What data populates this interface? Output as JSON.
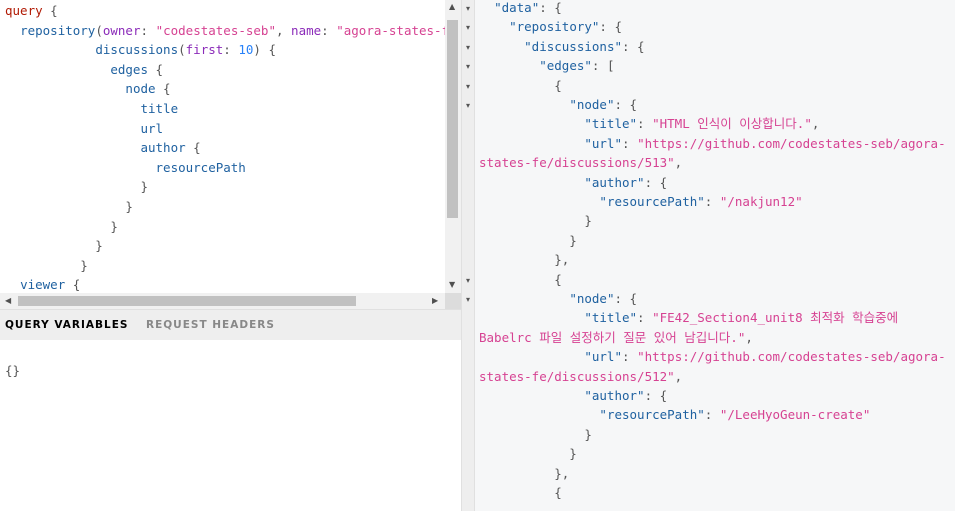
{
  "query_editor": {
    "lines": [
      [
        [
          "kw",
          "query"
        ],
        [
          "punct",
          " {"
        ]
      ],
      [
        [
          "punct",
          "  "
        ],
        [
          "field",
          "repository"
        ],
        [
          "punct",
          "("
        ],
        [
          "arg",
          "owner"
        ],
        [
          "punct",
          ": "
        ],
        [
          "str",
          "\"codestates-seb\""
        ],
        [
          "punct",
          ", "
        ],
        [
          "arg",
          "name"
        ],
        [
          "punct",
          ": "
        ],
        [
          "str",
          "\"agora-states-fe\""
        ],
        [
          "punct",
          ")"
        ]
      ],
      [
        [
          "punct",
          "            "
        ],
        [
          "field",
          "discussions"
        ],
        [
          "punct",
          "("
        ],
        [
          "arg",
          "first"
        ],
        [
          "punct",
          ": "
        ],
        [
          "num",
          "10"
        ],
        [
          "punct",
          ") {"
        ]
      ],
      [
        [
          "punct",
          "              "
        ],
        [
          "field",
          "edges"
        ],
        [
          "punct",
          " {"
        ]
      ],
      [
        [
          "punct",
          "                "
        ],
        [
          "field",
          "node"
        ],
        [
          "punct",
          " {"
        ]
      ],
      [
        [
          "punct",
          "                  "
        ],
        [
          "field",
          "title"
        ]
      ],
      [
        [
          "punct",
          "                  "
        ],
        [
          "field",
          "url"
        ]
      ],
      [
        [
          "punct",
          "                  "
        ],
        [
          "field",
          "author"
        ],
        [
          "punct",
          " {"
        ]
      ],
      [
        [
          "punct",
          "                    "
        ],
        [
          "field",
          "resourcePath"
        ]
      ],
      [
        [
          "punct",
          "                  }"
        ]
      ],
      [
        [
          "punct",
          "                }"
        ]
      ],
      [
        [
          "punct",
          "              }"
        ]
      ],
      [
        [
          "punct",
          "            }"
        ]
      ],
      [
        [
          "punct",
          "          }"
        ]
      ],
      [
        [
          "punct",
          "  "
        ],
        [
          "field",
          "viewer"
        ],
        [
          "punct",
          " {"
        ]
      ]
    ]
  },
  "tabs": {
    "variables": "QUERY VARIABLES",
    "headers": "REQUEST HEADERS"
  },
  "variables_editor": {
    "text": "{}"
  },
  "result": {
    "lines": [
      [
        [
          "punct",
          "  "
        ],
        [
          "rkey",
          "\"data\""
        ],
        [
          "punct",
          ": {"
        ]
      ],
      [
        [
          "punct",
          "    "
        ],
        [
          "rkey",
          "\"repository\""
        ],
        [
          "punct",
          ": {"
        ]
      ],
      [
        [
          "punct",
          "      "
        ],
        [
          "rkey",
          "\"discussions\""
        ],
        [
          "punct",
          ": {"
        ]
      ],
      [
        [
          "punct",
          "        "
        ],
        [
          "rkey",
          "\"edges\""
        ],
        [
          "punct",
          ": ["
        ]
      ],
      [
        [
          "punct",
          "          {"
        ]
      ],
      [
        [
          "punct",
          "            "
        ],
        [
          "rkey",
          "\"node\""
        ],
        [
          "punct",
          ": {"
        ]
      ],
      [
        [
          "punct",
          "              "
        ],
        [
          "rkey",
          "\"title\""
        ],
        [
          "punct",
          ": "
        ],
        [
          "rstr",
          "\"HTML 인식이 이상합니다.\""
        ],
        [
          "punct",
          ","
        ]
      ],
      [
        [
          "punct",
          "              "
        ],
        [
          "rkey",
          "\"url\""
        ],
        [
          "punct",
          ": "
        ],
        [
          "rstr",
          "\"https://github.com/codestates-seb/agora-"
        ]
      ],
      [
        [
          "rstr",
          "states-fe/discussions/513\""
        ],
        [
          "punct",
          ","
        ]
      ],
      [
        [
          "punct",
          "              "
        ],
        [
          "rkey",
          "\"author\""
        ],
        [
          "punct",
          ": {"
        ]
      ],
      [
        [
          "punct",
          "                "
        ],
        [
          "rkey",
          "\"resourcePath\""
        ],
        [
          "punct",
          ": "
        ],
        [
          "rstr",
          "\"/nakjun12\""
        ]
      ],
      [
        [
          "punct",
          "              }"
        ]
      ],
      [
        [
          "punct",
          "            }"
        ]
      ],
      [
        [
          "punct",
          "          },"
        ]
      ],
      [
        [
          "punct",
          "          {"
        ]
      ],
      [
        [
          "punct",
          "            "
        ],
        [
          "rkey",
          "\"node\""
        ],
        [
          "punct",
          ": {"
        ]
      ],
      [
        [
          "punct",
          "              "
        ],
        [
          "rkey",
          "\"title\""
        ],
        [
          "punct",
          ": "
        ],
        [
          "rstr",
          "\"FE42_Section4_unit8 최적화 학습중에"
        ]
      ],
      [
        [
          "rstr",
          "Babelrc 파일 설정하기 질문 있어 남깁니다.\""
        ],
        [
          "punct",
          ","
        ]
      ],
      [
        [
          "punct",
          "              "
        ],
        [
          "rkey",
          "\"url\""
        ],
        [
          "punct",
          ": "
        ],
        [
          "rstr",
          "\"https://github.com/codestates-seb/agora-"
        ]
      ],
      [
        [
          "rstr",
          "states-fe/discussions/512\""
        ],
        [
          "punct",
          ","
        ]
      ],
      [
        [
          "punct",
          "              "
        ],
        [
          "rkey",
          "\"author\""
        ],
        [
          "punct",
          ": {"
        ]
      ],
      [
        [
          "punct",
          "                "
        ],
        [
          "rkey",
          "\"resourcePath\""
        ],
        [
          "punct",
          ": "
        ],
        [
          "rstr",
          "\"/LeeHyoGeun-create\""
        ]
      ],
      [
        [
          "punct",
          "              }"
        ]
      ],
      [
        [
          "punct",
          "            }"
        ]
      ],
      [
        [
          "punct",
          "          },"
        ]
      ],
      [
        [
          "punct",
          "          {"
        ]
      ]
    ]
  },
  "fold_arrows": [
    "▾",
    "▾",
    "▾",
    "▾",
    "▾",
    "▾",
    "",
    "",
    "",
    "",
    "",
    "",
    "",
    "",
    "▾",
    "▾"
  ]
}
